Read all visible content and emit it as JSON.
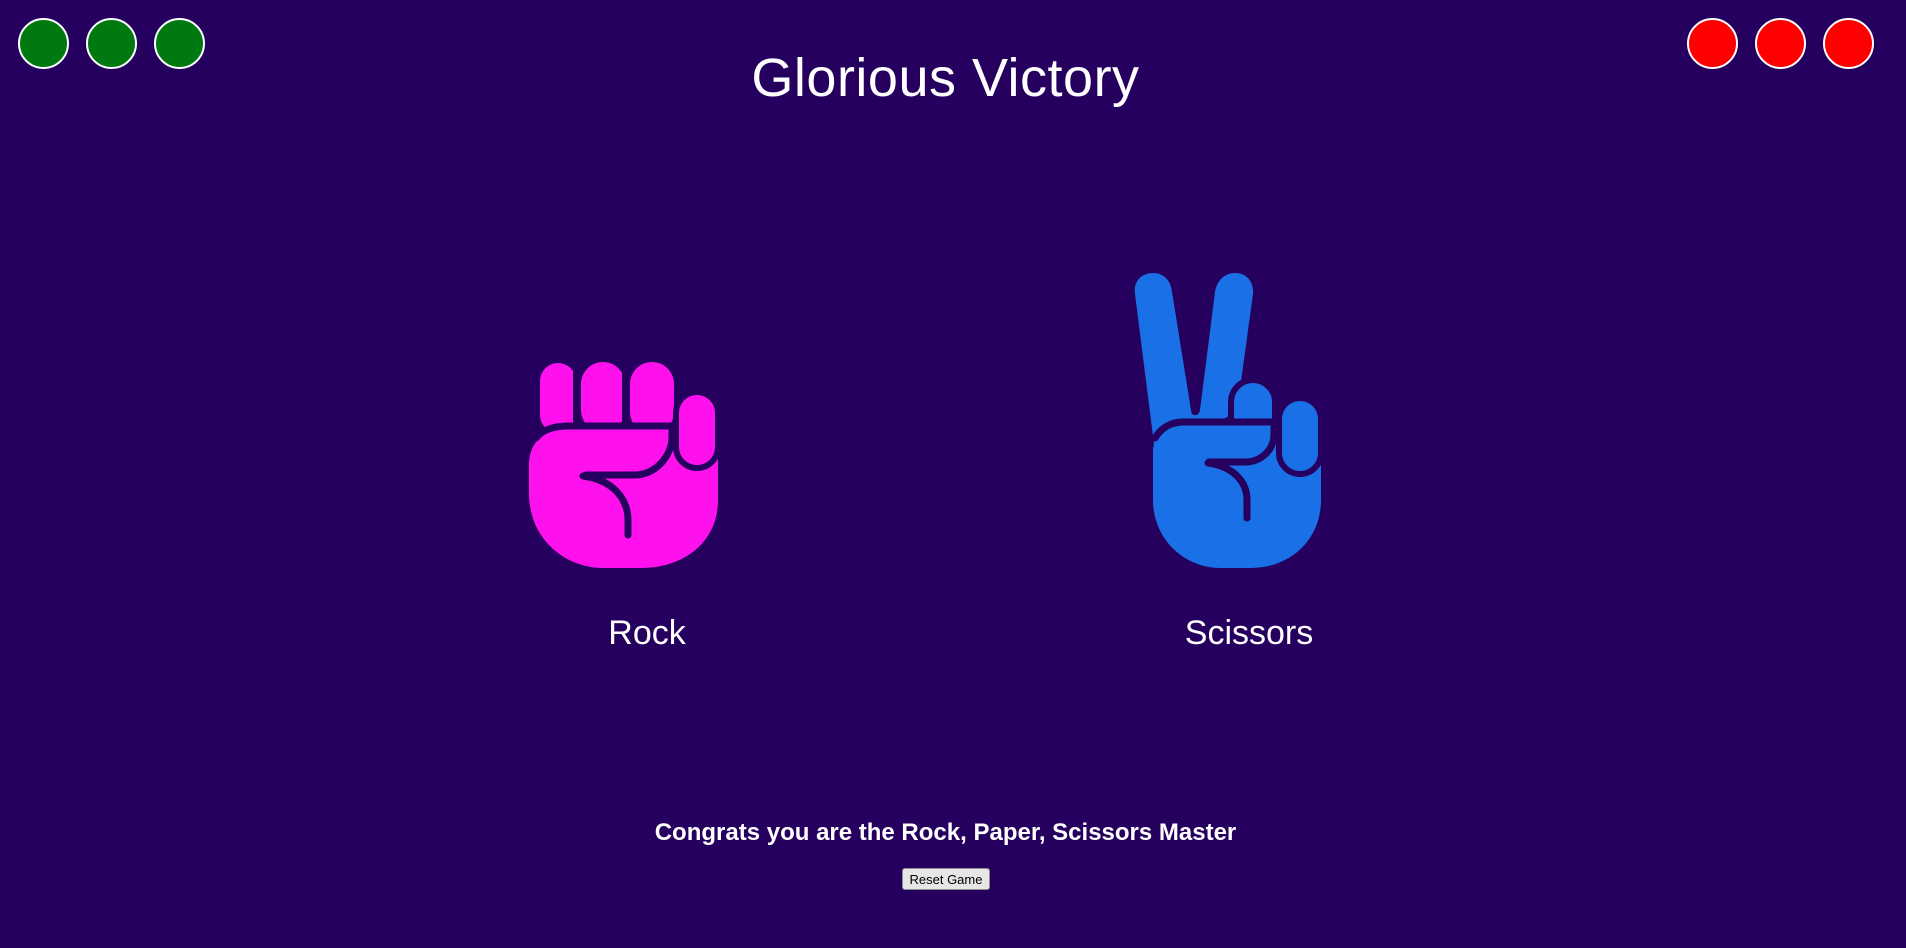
{
  "game": {
    "title": "Glorious Victory",
    "message": "Congrats you are the Rock, Paper, Scissors Master",
    "reset_label": "Reset Game"
  },
  "scores": {
    "player": {
      "wins": 3,
      "color": "#007a10"
    },
    "computer": {
      "wins": 3,
      "color": "#ff0000"
    }
  },
  "choices": {
    "player": {
      "label": "Rock",
      "icon": "rock-fist-icon",
      "color": "#ff11ee"
    },
    "computer": {
      "label": "Scissors",
      "icon": "scissors-victory-hand-icon",
      "color": "#1a70e6"
    }
  },
  "theme": {
    "background": "#26005e",
    "text": "#ffffff",
    "hand_outline": "#26005e"
  }
}
